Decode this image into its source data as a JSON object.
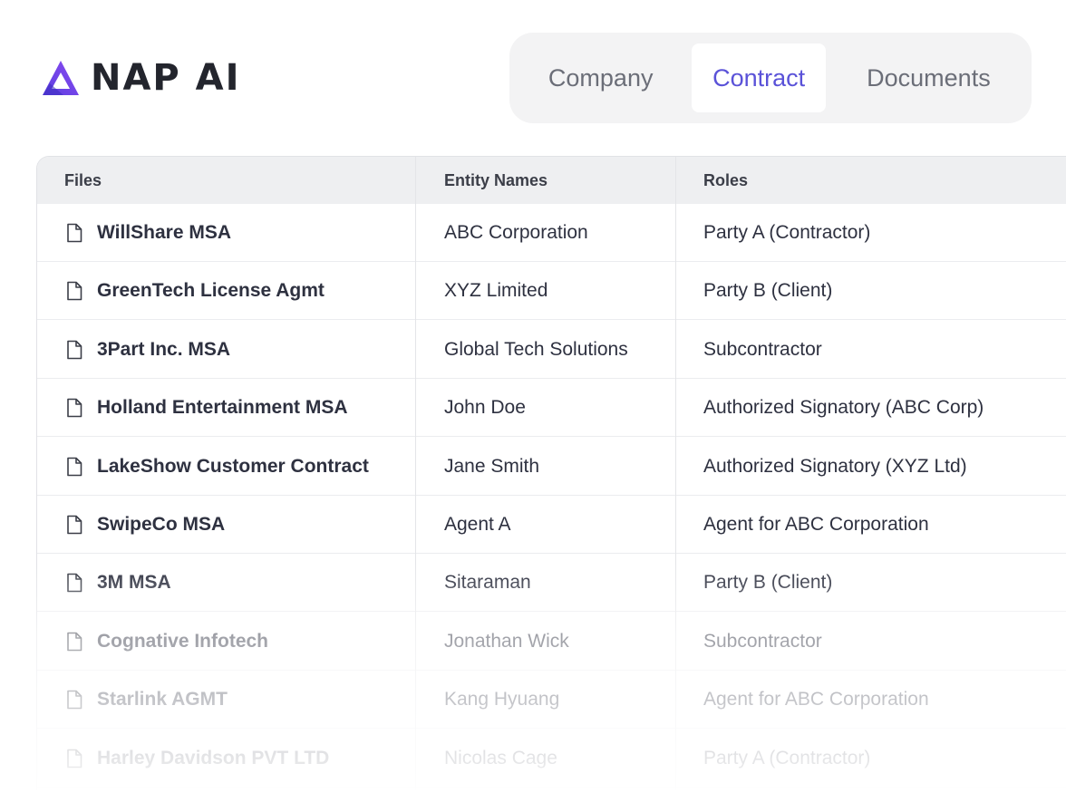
{
  "brand": {
    "logo_text": "NAP AI",
    "gradient_start": "#5b3fe0",
    "gradient_end": "#8a4af0"
  },
  "tabs": [
    {
      "label": "Company",
      "active": false
    },
    {
      "label": "Contract",
      "active": true
    },
    {
      "label": "Documents",
      "active": false
    }
  ],
  "table": {
    "columns": [
      "Files",
      "Entity Names",
      "Roles"
    ],
    "rows": [
      {
        "file": "WillShare MSA",
        "entity": "ABC Corporation",
        "role": "Party A (Contractor)"
      },
      {
        "file": "GreenTech License Agmt",
        "entity": "XYZ Limited",
        "role": "Party B (Client)"
      },
      {
        "file": "3Part Inc. MSA",
        "entity": "Global Tech Solutions",
        "role": "Subcontractor"
      },
      {
        "file": "Holland Entertainment MSA",
        "entity": "John Doe",
        "role": "Authorized Signatory (ABC Corp)"
      },
      {
        "file": "LakeShow Customer Contract",
        "entity": "Jane Smith",
        "role": "Authorized Signatory (XYZ Ltd)"
      },
      {
        "file": "SwipeCo MSA",
        "entity": "Agent A",
        "role": "Agent for ABC Corporation"
      },
      {
        "file": "3M MSA",
        "entity": "Sitaraman",
        "role": "Party B (Client)"
      },
      {
        "file": "Cognative Infotech",
        "entity": "Jonathan Wick",
        "role": "Subcontractor"
      },
      {
        "file": "Starlink AGMT",
        "entity": "Kang Hyuang",
        "role": "Agent for ABC Corporation"
      },
      {
        "file": "Harley Davidson PVT LTD",
        "entity": "Nicolas Cage",
        "role": "Party A (Contractor)"
      }
    ]
  },
  "colors": {
    "accent": "#5a52d8",
    "text": "#2e3140",
    "muted": "#6b6e78",
    "tab_bg": "#f3f3f4",
    "header_bg": "#eeeff1"
  }
}
